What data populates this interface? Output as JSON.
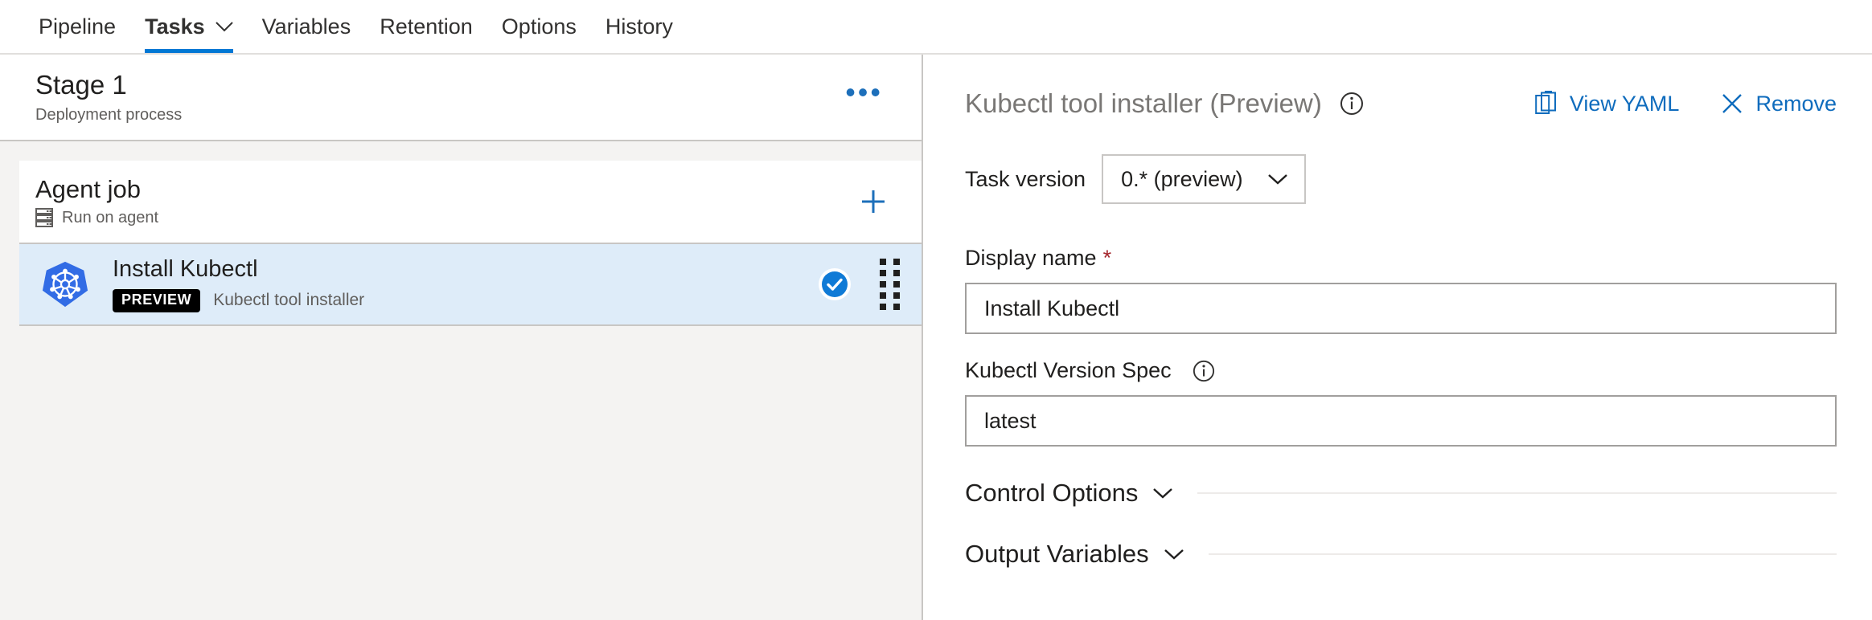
{
  "colors": {
    "accent": "#0078d4",
    "link": "#0f6cbd",
    "selected_row_bg": "#deecf9",
    "required_star": "#a4262c",
    "badge_bg": "#000000",
    "k8s_blue": "#326ce5",
    "muted_text": "#605e5c",
    "title_muted": "#797775",
    "pane_bg": "#f4f3f2"
  },
  "tabs": [
    {
      "label": "Pipeline",
      "active": false,
      "has_chevron": false,
      "icon": ""
    },
    {
      "label": "Tasks",
      "active": true,
      "has_chevron": true,
      "icon": "chevron-down-icon"
    },
    {
      "label": "Variables",
      "active": false,
      "has_chevron": false,
      "icon": ""
    },
    {
      "label": "Retention",
      "active": false,
      "has_chevron": false,
      "icon": ""
    },
    {
      "label": "Options",
      "active": false,
      "has_chevron": false,
      "icon": ""
    },
    {
      "label": "History",
      "active": false,
      "has_chevron": false,
      "icon": ""
    }
  ],
  "stage": {
    "title": "Stage 1",
    "subtitle": "Deployment process",
    "menu_icon": "ellipsis-icon",
    "menu_glyph": "•••"
  },
  "job": {
    "title": "Agent job",
    "subtitle": "Run on agent",
    "subtitle_icon": "server-rack-icon",
    "add_icon": "plus-icon"
  },
  "task": {
    "title": "Install Kubectl",
    "badge": "PREVIEW",
    "description": "Kubectl tool installer",
    "logo_icon": "kubernetes-icon",
    "status_icon": "check-circle-icon",
    "drag_icon": "drag-handle-icon",
    "selected": true
  },
  "details": {
    "title": "Kubectl tool installer (Preview)",
    "title_info_icon": "info-icon",
    "actions": [
      {
        "label": "View YAML",
        "icon": "clipboard-icon"
      },
      {
        "label": "Remove",
        "icon": "close-x-icon"
      }
    ],
    "task_version": {
      "label": "Task version",
      "value": "0.* (preview)",
      "options": [
        "0.* (preview)"
      ],
      "chevron_icon": "chevron-down-icon"
    },
    "display_name": {
      "label": "Display name",
      "required": true,
      "required_glyph": "*",
      "value": "Install Kubectl",
      "placeholder": ""
    },
    "version_spec": {
      "label": "Kubectl Version Spec",
      "info_icon": "info-icon",
      "value": "latest",
      "placeholder": ""
    },
    "sections": [
      {
        "label": "Control Options",
        "expanded": false,
        "chevron_icon": "chevron-down-icon"
      },
      {
        "label": "Output Variables",
        "expanded": false,
        "chevron_icon": "chevron-down-icon"
      }
    ]
  }
}
